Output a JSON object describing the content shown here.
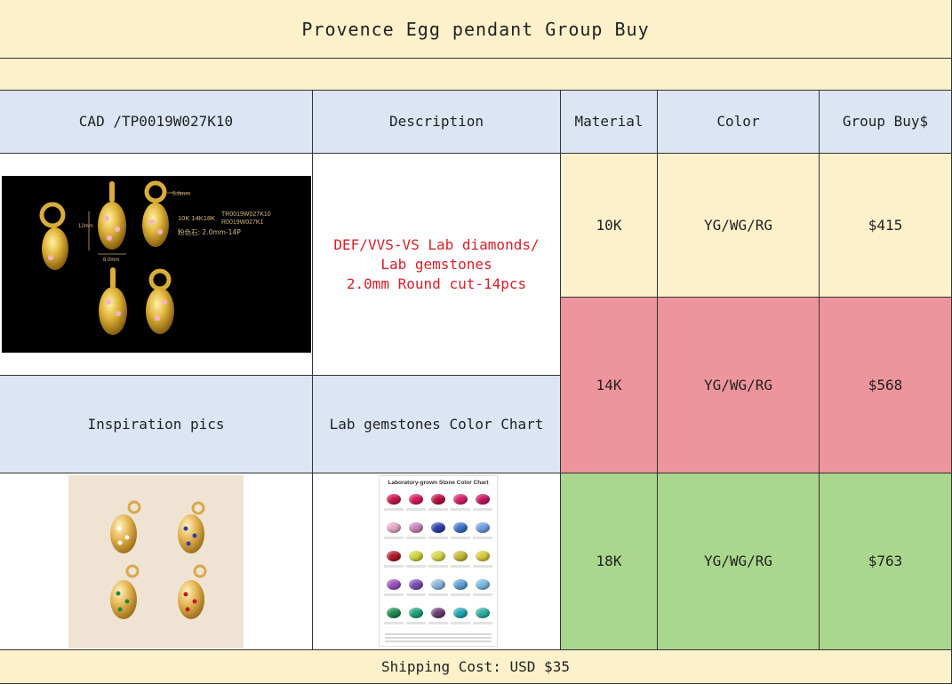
{
  "title": "Provence Egg pendant Group Buy",
  "headers": {
    "cad": "CAD /TP0019W027K10",
    "description": "Description",
    "material": "Material",
    "color": "Color",
    "group_buy": "Group Buy$"
  },
  "description_lines": [
    "DEF/VVS-VS Lab diamonds/",
    "Lab gemstones",
    "2.0mm Round cut-14pcs"
  ],
  "rows": [
    {
      "material": "10K",
      "color": "YG/WG/RG",
      "price": "$415"
    },
    {
      "material": "14K",
      "color": "YG/WG/RG",
      "price": "$568"
    },
    {
      "material": "18K",
      "color": "YG/WG/RG",
      "price": "$763"
    }
  ],
  "inspiration_label": "Inspiration pics",
  "chart_label": "Lab gemstones Color Chart",
  "shipping": "Shipping Cost: USD $35",
  "cad_annotations": {
    "loop": "5.0mm",
    "height": "12mm",
    "width": "8.0mm",
    "metals": "10K 14K18K",
    "code1": "TR0019W027K10",
    "code2": "R0019W027K1",
    "stone_note": "粉色石: 2.0mm-14P"
  },
  "color_chart": {
    "title": "Laboratory-grown Stone Color Chart",
    "swatch_colors": [
      "#c8154a",
      "#d8195c",
      "#b8113f",
      "#d61f6a",
      "#c51563",
      "#e6a7c7",
      "#c982b8",
      "#2c3da8",
      "#3d72c9",
      "#6e9de0",
      "#b3182a",
      "#cfd63a",
      "#d9d64a",
      "#c9b934",
      "#dcc93a",
      "#9a4fbf",
      "#7a4fb5",
      "#8ab6dc",
      "#5d9fd8",
      "#79b9e4",
      "#1f8a4c",
      "#1aa27a",
      "#6a3b72",
      "#22a6b8",
      "#2bb0a0"
    ]
  },
  "colors": {
    "cream": "#fdf1cb",
    "blue": "#dbe5f3",
    "pink": "#ee949c",
    "green": "#a9d78d",
    "red_text": "#d6202a"
  }
}
